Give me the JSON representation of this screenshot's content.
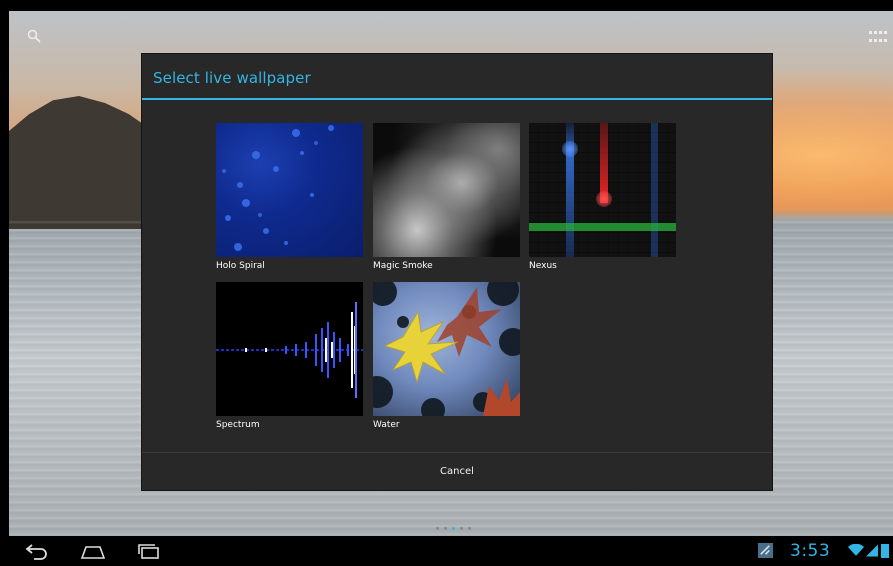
{
  "dialog": {
    "title": "Select live wallpaper",
    "wallpapers": [
      {
        "label": "Holo Spiral",
        "preview": "holo-spiral-preview"
      },
      {
        "label": "Magic Smoke",
        "preview": "magic-smoke-preview"
      },
      {
        "label": "Nexus",
        "preview": "nexus-preview"
      },
      {
        "label": "Spectrum",
        "preview": "spectrum-preview"
      },
      {
        "label": "Water",
        "preview": "water-preview"
      }
    ],
    "cancel_label": "Cancel"
  },
  "status_bar": {
    "time": "3:53"
  },
  "icons": {
    "search": "search-icon",
    "apps": "apps-grid-icon",
    "back": "back-icon",
    "home": "home-icon",
    "recents": "recent-apps-icon",
    "notification": "notification-icon",
    "wifi": "wifi-icon",
    "signal": "signal-icon",
    "battery": "battery-icon"
  },
  "colors": {
    "accent": "#33b5e5",
    "dialog_bg": "#282828",
    "navbar_bg": "#000000"
  }
}
